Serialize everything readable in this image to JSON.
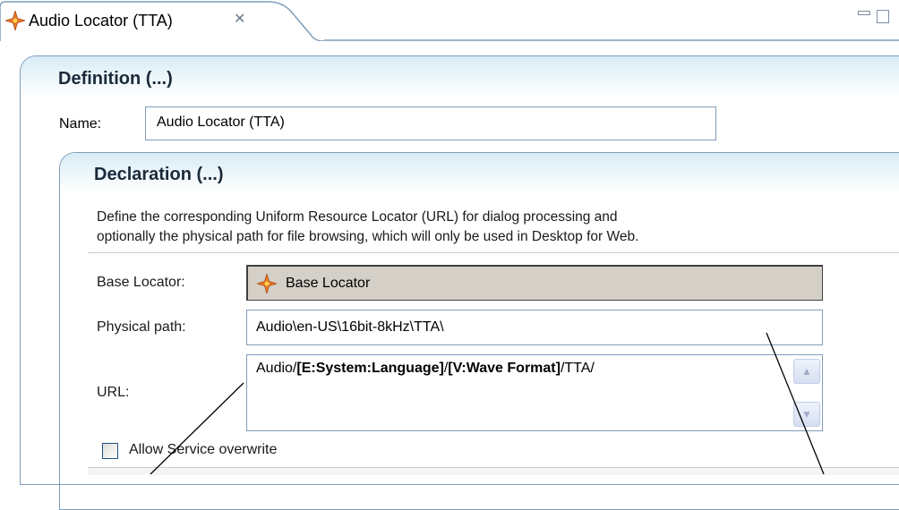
{
  "tab": {
    "title": "Audio Locator (TTA)",
    "close_glyph": "✕",
    "icon": "locator-compass-icon"
  },
  "window_controls": {
    "minimize_icon": "minimize-icon",
    "maximize_icon": "maximize-icon"
  },
  "definition": {
    "title": "Definition (...)",
    "name_label": "Name:",
    "name_value": "Audio Locator (TTA)"
  },
  "declaration": {
    "title": "Declaration (...)",
    "description_line1": "Define the corresponding Uniform Resource Locator (URL) for dialog processing and",
    "description_line2": "optionally the physical path for file browsing, which will only be used in Desktop for Web.",
    "base_locator_label": "Base Locator:",
    "base_locator_value": "Base Locator",
    "physical_path_label": "Physical path:",
    "physical_path_value": "Audio\\en-US\\16bit-8kHz\\TTA\\",
    "url_label": "URL:",
    "url_parts": {
      "p1": "Audio/",
      "p2": "[E:System:Language]",
      "p3": "/",
      "p4": "[V:Wave Format]",
      "p5": "/TTA/"
    },
    "allow_overwrite_label": "Allow Service overwrite",
    "allow_overwrite_checked": false
  },
  "colors": {
    "accent_orange": "#e8782a",
    "border_blue": "#7f9db9",
    "header_gradient": "#d8ecf6"
  }
}
